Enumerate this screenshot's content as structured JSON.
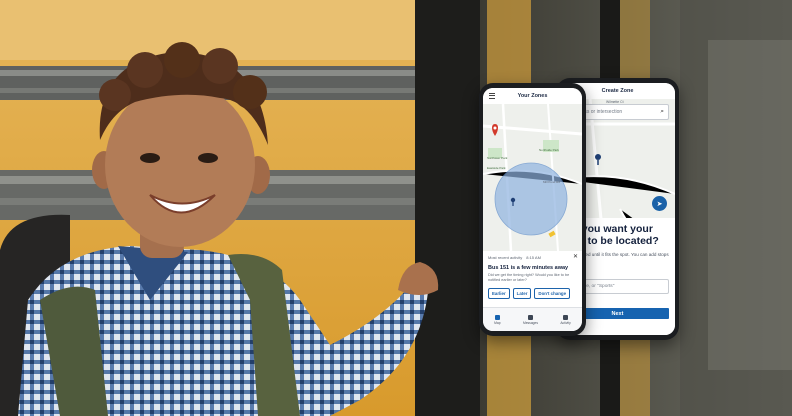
{
  "colors": {
    "brand_blue": "#1663b0",
    "bus_yellow": "#e2a62a",
    "shirt_blue": "#2e4f7c",
    "pin_red": "#d23a2b",
    "zone_blue": "#8fb3e0"
  },
  "back_phone": {
    "title": "Create Zone",
    "street_label": "Wilmette Ct",
    "search_placeholder": "Address or intersection",
    "search_icon": "search-icon",
    "locate_icon": "location-arrow-icon",
    "question": "do you want your one to be located?",
    "help_text": "be renamed until it fits the spot. You can add stops later.",
    "name_label": "e a name:",
    "name_placeholder": "Daycare, or \"Sports\"",
    "next_label": "Next"
  },
  "front_phone": {
    "title": "Your Zones",
    "menu_icon": "hamburger-menu-icon",
    "map_labels": [
      "Sunflower Park",
      "Northside Park",
      "Eastside Park",
      "Mill Pond Rd"
    ],
    "alert": {
      "meta_left": "Most recent activity",
      "meta_time": "8:15 AM",
      "title": "Bus 151 is a few minutes away",
      "body": "Did we get the timing right? Would you like to be notified earlier or later?",
      "actions": [
        "Earlier",
        "Later",
        "Don't change"
      ]
    },
    "tabs": [
      {
        "label": "Map",
        "icon": "map-icon"
      },
      {
        "label": "Messages",
        "icon": "messages-icon"
      },
      {
        "label": "Activity",
        "icon": "bell-icon"
      }
    ]
  }
}
